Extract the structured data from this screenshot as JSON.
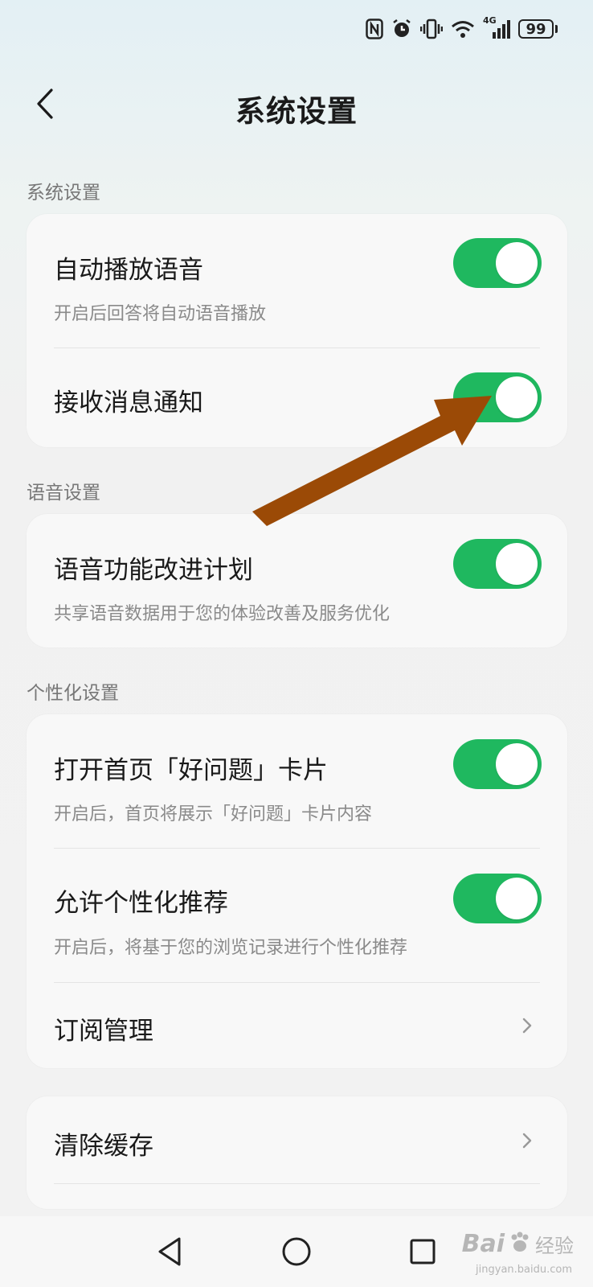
{
  "status_bar": {
    "icons": [
      "nfc-icon",
      "alarm-icon",
      "vibrate-icon",
      "wifi-icon",
      "signal-4g-icon"
    ],
    "network_label": "4G",
    "battery_level": "99"
  },
  "header": {
    "title": "系统设置"
  },
  "sections": [
    {
      "title": "系统设置",
      "items": [
        {
          "title": "自动播放语音",
          "description": "开启后回答将自动语音播放",
          "toggle_on": true
        },
        {
          "title": "接收消息通知",
          "toggle_on": true
        }
      ]
    },
    {
      "title": "语音设置",
      "items": [
        {
          "title": "语音功能改进计划",
          "description": "共享语音数据用于您的体验改善及服务优化",
          "toggle_on": true
        }
      ]
    },
    {
      "title": "个性化设置",
      "items": [
        {
          "title": "打开首页「好问题」卡片",
          "description": "开启后，首页将展示「好问题」卡片内容",
          "toggle_on": true
        },
        {
          "title": "允许个性化推荐",
          "description": "开启后，将基于您的浏览记录进行个性化推荐",
          "toggle_on": true
        },
        {
          "title": "订阅管理"
        }
      ]
    },
    {
      "items": [
        {
          "title": "清除缓存"
        }
      ]
    }
  ],
  "colors": {
    "toggle_on": "#1fb85f",
    "annotation_arrow": "#9b4a06"
  },
  "watermark": {
    "logo": "Bai",
    "cn": "经验",
    "url": "jingyan.baidu.com"
  }
}
